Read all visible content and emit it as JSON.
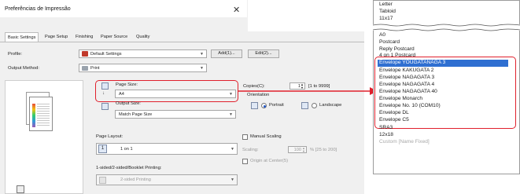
{
  "dialog": {
    "title": "Preferências de Impressão",
    "close_glyph": "✕",
    "tabs": [
      "Basic Settings",
      "Page Setup",
      "Finishing",
      "Paper Source",
      "Quality"
    ],
    "profile_label": "Profile:",
    "profile_value": "Default Settings",
    "add_button": "Add(1)...",
    "edit_button": "Edit(2)...",
    "output_method_label": "Output Method:",
    "output_method_value": "Print",
    "page_size_label": "Page Size:",
    "page_size_value": "A4",
    "output_size_label": "Output Size:",
    "output_size_value": "Match Page Size",
    "copies_label": "Copies(C):",
    "copies_value": "1",
    "copies_range": "[1 to 9999]",
    "orientation_label": "Orientation",
    "portrait_label": "Portrait",
    "landscape_label": "Landscape",
    "page_layout_label": "Page Layout:",
    "page_layout_value": "1 on 1",
    "manual_scaling_label": "Manual Scaling",
    "scaling_label": "Scaling:",
    "scaling_value": "100",
    "scaling_range": "% [25 to 200]",
    "origin_label": "Origin at Center(5)",
    "sided_label": "1-sided/2-sided/Booklet Printing:",
    "sided_value": "2-sided Printing"
  },
  "paper_list": {
    "top_items": [
      "Letter",
      "Tabloid",
      "11x17"
    ],
    "middle_items": [
      "A0",
      "Postcard",
      "Reply Postcard"
    ],
    "partial_item": "4 on 1 Postcard",
    "highlighted_items": [
      "Envelope YOUGATANAGA 3",
      "Envelope KAKUGATA 2",
      "Envelope NAGAGATA 3",
      "Envelope NAGAGATA 4",
      "Envelope NAGAGATA 40",
      "Envelope Monarch",
      "Envelope No. 10 (COM10)",
      "Envelope DL",
      "Envelope C5"
    ],
    "selected_index": 0,
    "bottom_items": [
      "SRA3",
      "12x18"
    ],
    "custom_item": "Custom [Name Fixed]"
  },
  "colors": {
    "highlight_red": "#e0202c",
    "selection_blue": "#2f6fd1"
  }
}
